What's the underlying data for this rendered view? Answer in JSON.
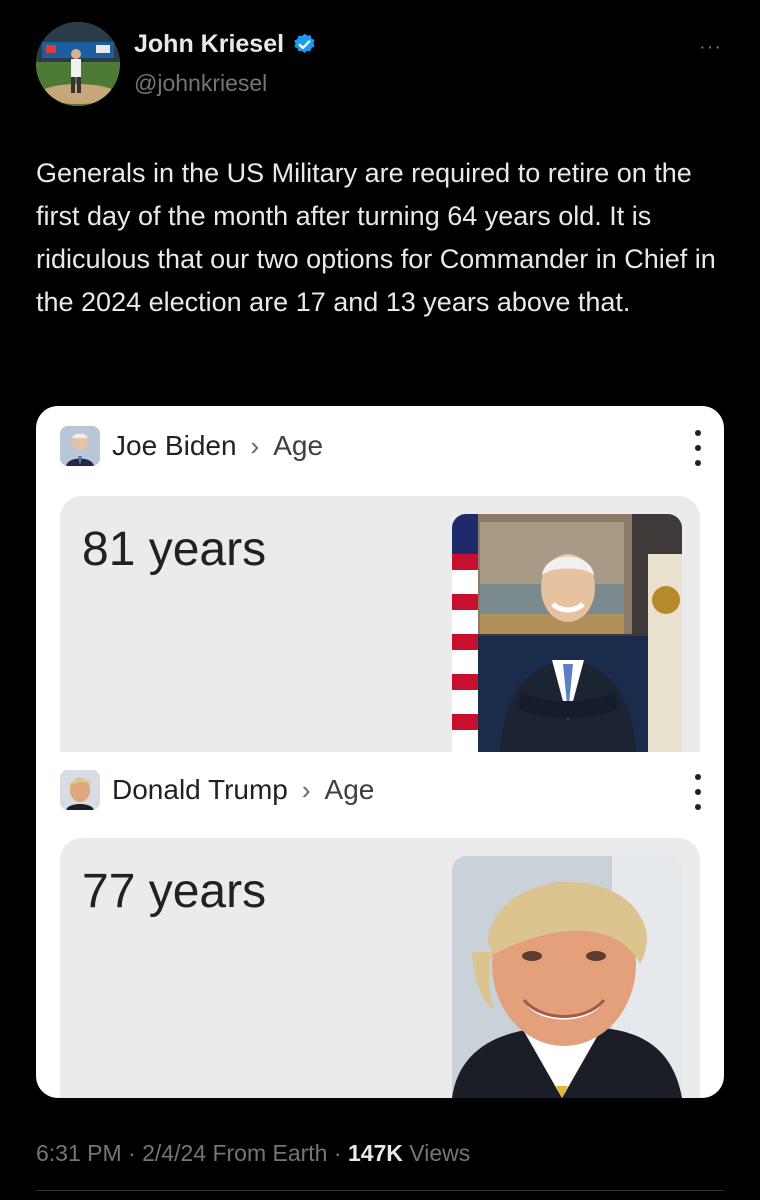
{
  "author": {
    "name": "John Kriesel",
    "handle": "@johnkriesel"
  },
  "tweet": {
    "text": "Generals in the US Military are required to retire on the first day of the month after turning 64 years old. It is ridiculous that our two options for Commander in Chief in the 2024 election are 17 and 13 years above that."
  },
  "more_label": "···",
  "card": {
    "results": [
      {
        "name": "Joe Biden",
        "separator": "›",
        "attribute": "Age",
        "value": "81 years"
      },
      {
        "name": "Donald Trump",
        "separator": "›",
        "attribute": "Age",
        "value": "77 years"
      }
    ]
  },
  "meta": {
    "time": "6:31 PM",
    "dot1": " · ",
    "date": "2/4/24",
    "source": " From Earth",
    "dot2": " · ",
    "views_count": "147K",
    "views_label": " Views"
  },
  "colors": {
    "background": "#000000",
    "verified": "#1d9bf0",
    "muted": "#71767b",
    "card": "#ffffff",
    "answer_box": "#ebebeb"
  }
}
